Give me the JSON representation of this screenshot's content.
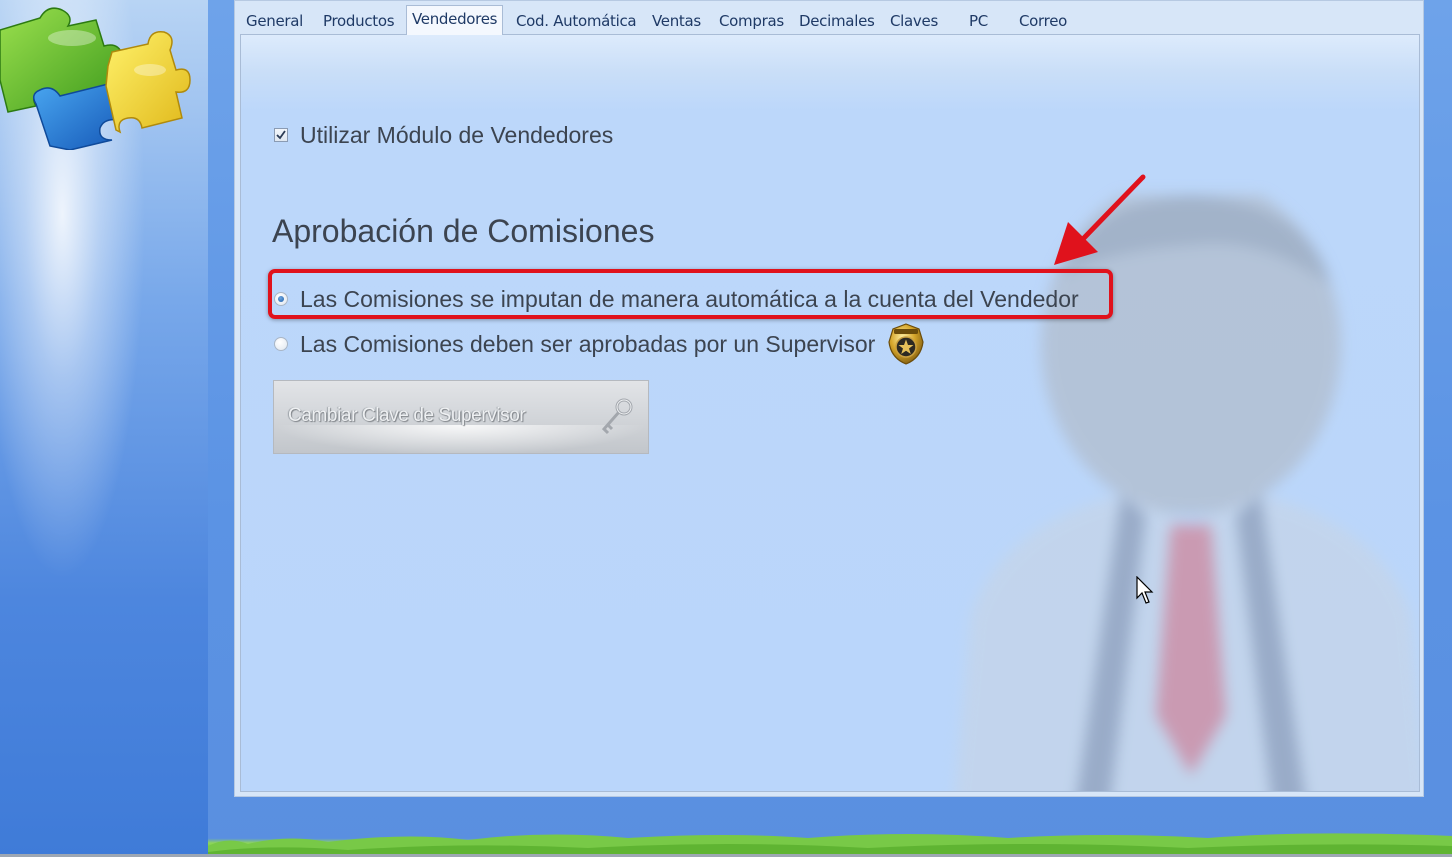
{
  "tabs": [
    {
      "label": "General",
      "active": false
    },
    {
      "label": "Productos",
      "active": false
    },
    {
      "label": "Vendedores",
      "active": true
    },
    {
      "label": "Cod. Automática",
      "active": false
    },
    {
      "label": "Ventas",
      "active": false
    },
    {
      "label": "Compras",
      "active": false
    },
    {
      "label": "Decimales",
      "active": false
    },
    {
      "label": "Claves",
      "active": false
    },
    {
      "label": "PC",
      "active": false
    },
    {
      "label": "Correo",
      "active": false
    }
  ],
  "vendedores": {
    "use_module": {
      "label": "Utilizar Módulo de Vendedores",
      "checked": true
    },
    "section_title": "Aprobación de Comisiones",
    "options": [
      {
        "label": "Las Comisiones se imputan de manera automática a la cuenta del Vendedor",
        "selected": true,
        "highlighted": true
      },
      {
        "label": "Las Comisiones deben ser aprobadas por un Supervisor",
        "selected": false,
        "icon": "security-badge-icon"
      }
    ],
    "change_password_button": {
      "label": "Cambiar Clave de Supervisor",
      "enabled": false,
      "icon": "key-icon"
    }
  },
  "annotation": {
    "color": "#e0121c"
  },
  "colors": {
    "panel_bg": "#bad6fb",
    "desktop_bg": "#5b93e4",
    "text": "#3c4450",
    "tab_text": "#1f3a66"
  }
}
